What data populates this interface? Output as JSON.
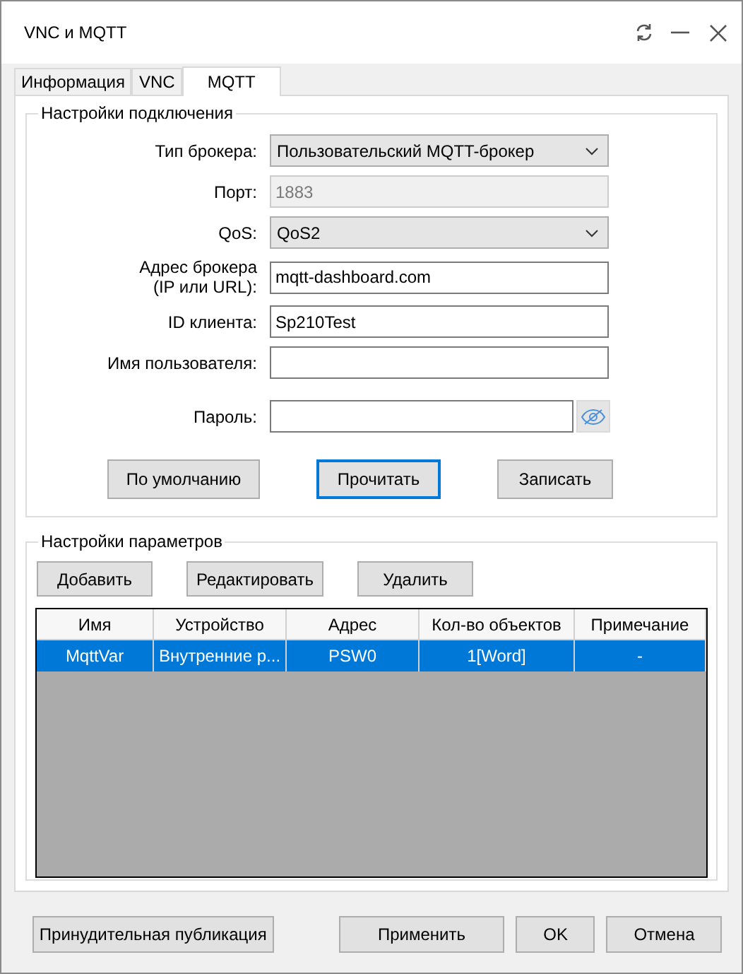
{
  "window": {
    "title": "VNC и MQTT"
  },
  "tabs": [
    {
      "label": "Информация",
      "selected": false
    },
    {
      "label": "VNC",
      "selected": false
    },
    {
      "label": "MQTT",
      "selected": true
    }
  ],
  "connection_settings": {
    "title": "Настройки подключения",
    "fields": [
      {
        "kind": "dropdown",
        "label": "Тип брокера:",
        "value": "Пользовательский MQTT-брокер",
        "disabled": false
      },
      {
        "kind": "input",
        "label": "Порт:",
        "value": "1883",
        "disabled": true
      },
      {
        "kind": "dropdown",
        "label": "QoS:",
        "value": "QoS2",
        "disabled": false
      },
      {
        "kind": "input",
        "label": "Адрес брокера\n(IP или URL):",
        "value": "mqtt-dashboard.com",
        "disabled": false
      },
      {
        "kind": "input",
        "label": "ID клиента:",
        "value": "Sp210Test",
        "disabled": false
      },
      {
        "kind": "input",
        "label": "Имя пользователя:",
        "disabled": false
      },
      {
        "kind": "password",
        "label": "Пароль:",
        "disabled": false
      }
    ],
    "buttons": [
      {
        "label": "По умолчанию",
        "focused": false
      },
      {
        "label": "Прочитать",
        "focused": true
      },
      {
        "label": "Записать",
        "focused": false
      }
    ]
  },
  "parameter_settings": {
    "title": "Настройки параметров",
    "buttons": [
      "Добавить",
      "Редактировать",
      "Удалить"
    ],
    "table": {
      "columns": [
        "Имя",
        "Устройство",
        "Адрес",
        "Кол-во объектов",
        "Примечание"
      ],
      "rows": [
        {
          "cells": [
            "MqttVar",
            "Внутренние р...",
            "PSW0",
            "1[Word]",
            "-"
          ],
          "selected": true
        }
      ]
    }
  },
  "footer_buttons": [
    "Принудительная публикация",
    "Применить",
    "OK",
    "Отмена"
  ]
}
